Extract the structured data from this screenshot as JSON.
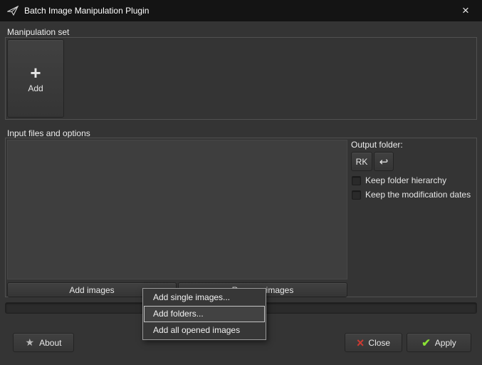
{
  "window": {
    "title": "Batch Image Manipulation Plugin",
    "close_glyph": "×"
  },
  "manipulation_set": {
    "frame_label": "Manipulation set",
    "add_button": {
      "plus_glyph": "+",
      "label": "Add"
    }
  },
  "input_files": {
    "frame_label": "Input files and options",
    "add_images_button": "Add images",
    "remove_images_button": "Remove images",
    "output_folder_label": "Output folder:",
    "folder_button": "RK",
    "undo_glyph": "↩",
    "keep_hierarchy_label": "Keep folder hierarchy",
    "keep_dates_label": "Keep the modification dates"
  },
  "context_menu": {
    "items": [
      {
        "label": "Add single images..."
      },
      {
        "label": "Add folders..."
      },
      {
        "label": "Add all opened images"
      }
    ]
  },
  "footer": {
    "star_glyph": "★",
    "about_button": "About",
    "close_glyph": "×",
    "close_button": "Close",
    "apply_glyph": "✔",
    "apply_button": "Apply"
  }
}
